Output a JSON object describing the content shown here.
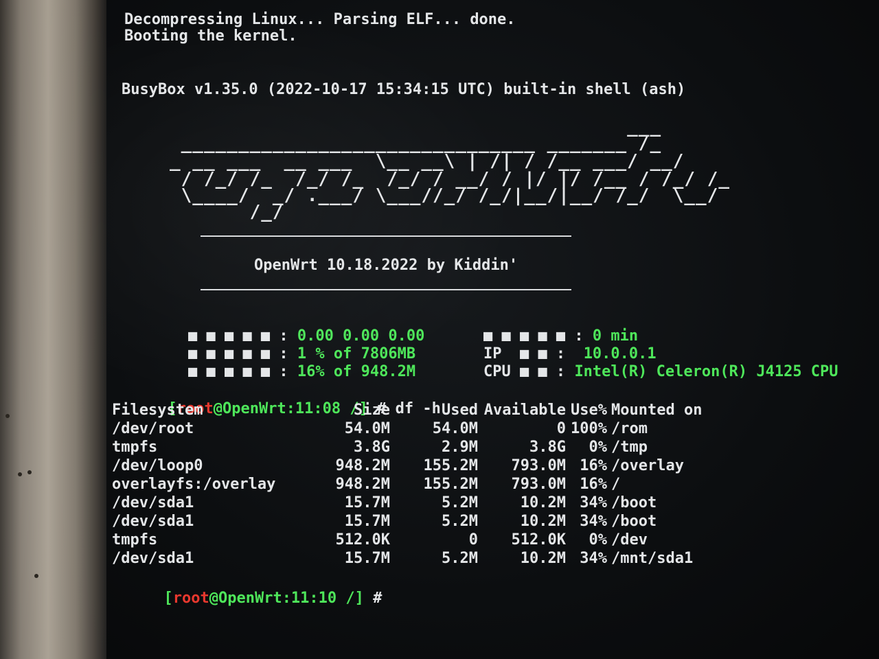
{
  "boot": {
    "line1": "Decompressing Linux... Parsing ELF... done.",
    "line2": "Booting the kernel.",
    "busybox": "BusyBox v1.35.0 (2022-10-17 15:34:15 UTC) built-in shell (ash)"
  },
  "logo": {
    "art": [
      "                                        ___",
      " _______________________________ _______ /_",
      "_ __ ___  __ ___  \\__ __\\ | /| / /__ ___/ __/",
      " / /_/ /_  /_/ /_  /_/ / __/ / |/ |/ /__ / /_/ /_",
      " \\____/  _/ .___/ \\___//_/ /_/|__/|__/ /_/  \\__/",
      "       /_/"
    ],
    "version_line": "OpenWrt 10.18.2022 by Kiddin'"
  },
  "stats": {
    "left": [
      {
        "label": "■ ■ ■ ■ ■ :",
        "value": "0.00 0.00 0.00"
      },
      {
        "label": "■ ■ ■ ■ ■ :",
        "value": "1 % of 7806MB"
      },
      {
        "label": "■ ■ ■ ■ ■ :",
        "value": "16% of 948.2M"
      }
    ],
    "right": [
      {
        "label": "■ ■ ■ ■ ■ :",
        "value": "0 min"
      },
      {
        "label": "IP  ■ ■ :",
        "value": "10.0.0.1"
      },
      {
        "label": "CPU ■ ■ :",
        "value": "Intel(R) Celeron(R) J4125 CPU"
      }
    ]
  },
  "prompt1": {
    "open": "[",
    "user": "root",
    "at": "@",
    "host": "OpenWrt",
    "time": ":11:08",
    "path": " /",
    "close": "]",
    "cmd": " # df -h"
  },
  "df": {
    "headers": [
      "Filesystem",
      "Size",
      "Used",
      "Available",
      "Use%",
      "Mounted on"
    ],
    "rows": [
      [
        "/dev/root",
        "54.0M",
        "54.0M",
        "0",
        "100%",
        "/rom"
      ],
      [
        "tmpfs",
        "3.8G",
        "2.9M",
        "3.8G",
        "0%",
        "/tmp"
      ],
      [
        "/dev/loop0",
        "948.2M",
        "155.2M",
        "793.0M",
        "16%",
        "/overlay"
      ],
      [
        "overlayfs:/overlay",
        "948.2M",
        "155.2M",
        "793.0M",
        "16%",
        "/"
      ],
      [
        "/dev/sda1",
        "15.7M",
        "5.2M",
        "10.2M",
        "34%",
        "/boot"
      ],
      [
        "/dev/sda1",
        "15.7M",
        "5.2M",
        "10.2M",
        "34%",
        "/boot"
      ],
      [
        "tmpfs",
        "512.0K",
        "0",
        "512.0K",
        "0%",
        "/dev"
      ],
      [
        "/dev/sda1",
        "15.7M",
        "5.2M",
        "10.2M",
        "34%",
        "/mnt/sda1"
      ]
    ]
  },
  "prompt2": {
    "open": "[",
    "user": "root",
    "at": "@",
    "host": "OpenWrt",
    "time": ":11:10",
    "path": " /",
    "close": "]",
    "cmd": " #"
  },
  "colors": {
    "text": "#e4e6e8",
    "green": "#4ee65a",
    "red": "#e8382e",
    "screen_bg": "#0c0e10",
    "bezel": "#8a8276"
  }
}
